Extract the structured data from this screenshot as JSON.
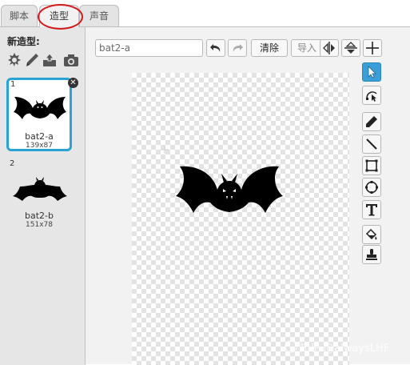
{
  "tabs": [
    {
      "label": "脚本"
    },
    {
      "label": "造型"
    },
    {
      "label": "声音"
    }
  ],
  "new_costume": {
    "title": "新造型:",
    "icons": [
      "sprite-library-icon",
      "paint-brush-icon",
      "upload-icon",
      "camera-icon"
    ]
  },
  "costumes": [
    {
      "number": "1",
      "name": "bat2-a",
      "size": "139x87"
    },
    {
      "number": "2",
      "name": "bat2-b",
      "size": "151x78"
    }
  ],
  "editor": {
    "name_value": "bat2-a",
    "clear_label": "清除",
    "import_label": "导入",
    "toolbar_icons": [
      "undo-icon",
      "redo-icon",
      "flip-horizontal-icon",
      "flip-vertical-icon",
      "set-center-icon"
    ]
  },
  "tools": [
    "select-icon",
    "reshape-icon",
    "pencil-icon",
    "line-icon",
    "rectangle-icon",
    "ellipse-icon",
    "text-icon",
    "fill-icon",
    "stamp-icon"
  ],
  "watermark": "知乎 @alwaysLHF",
  "colors": {
    "accent": "#29a3d5",
    "highlight_circle": "#d21a1a",
    "tool_active": "#3a9fd6"
  }
}
